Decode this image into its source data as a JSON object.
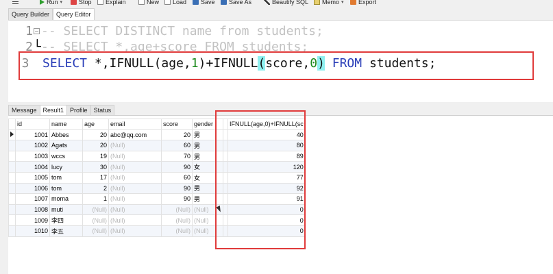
{
  "toolbar": {
    "run": "Run",
    "stop": "Stop",
    "explain": "Explain",
    "new": "New",
    "load": "Load",
    "save": "Save",
    "save_as": "Save As",
    "beautify": "Beautify SQL",
    "memo": "Memo",
    "export": "Export"
  },
  "editor_tabs": [
    "Query Builder",
    "Query Editor"
  ],
  "editor": {
    "line1": {
      "num": "1",
      "text": "-- SELECT DISTINCT name from students;"
    },
    "line2": {
      "num": "2",
      "text": "-- SELECT *,age+score FROM students;"
    },
    "line3": {
      "num": "3",
      "kw_select": "SELECT",
      "star": " *,",
      "fn1": "IFNULL",
      "open1": "(",
      "arg1": "age,",
      "lit1": "1",
      "close1_plus": ")+",
      "fn2": "IFNULL",
      "open2": "(",
      "arg2": "score,",
      "lit2": "0",
      "close2": ")",
      "kw_from": "FROM",
      "table": "students;"
    }
  },
  "result_tabs": [
    "Message",
    "Result1",
    "Profile",
    "Status"
  ],
  "grid": {
    "columns": [
      "id",
      "name",
      "age",
      "email",
      "score",
      "gender",
      "IFNULL(age,0)+IFNULL(sc"
    ],
    "rows": [
      [
        "1001",
        "Abbes",
        "20",
        "abc@qq.com",
        "20",
        "男",
        "40"
      ],
      [
        "1002",
        "Agats",
        "20",
        "(Null)",
        "60",
        "男",
        "80"
      ],
      [
        "1003",
        "wccs",
        "19",
        "(Null)",
        "70",
        "男",
        "89"
      ],
      [
        "1004",
        "lucy",
        "30",
        "(Null)",
        "90",
        "女",
        "120"
      ],
      [
        "1005",
        "tom",
        "17",
        "(Null)",
        "60",
        "女",
        "77"
      ],
      [
        "1006",
        "tom",
        "2",
        "(Null)",
        "90",
        "男",
        "92"
      ],
      [
        "1007",
        "moma",
        "1",
        "(Null)",
        "90",
        "男",
        "91"
      ],
      [
        "1008",
        "muti",
        "(Null)",
        "(Null)",
        "(Null)",
        "(Null)",
        "0"
      ],
      [
        "1009",
        "李四",
        "(Null)",
        "(Null)",
        "(Null)",
        "(Null)",
        "0"
      ],
      [
        "1010",
        "李五",
        "(Null)",
        "(Null)",
        "(Null)",
        "(Null)",
        "0"
      ]
    ]
  },
  "colors": {
    "highlight_box": "#e03b3b",
    "keyword": "#2a3eb8",
    "number": "#1b8a1b",
    "bracket_highlight": "#8ff0f0"
  }
}
